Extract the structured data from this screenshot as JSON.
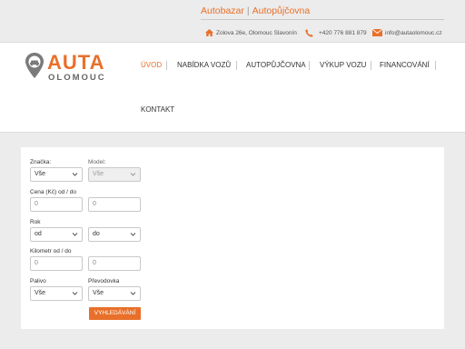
{
  "topbar": {
    "brand_primary": "Autobazar",
    "brand_separator": "|",
    "brand_secondary": "Autopůjčovna",
    "address": "Zolova 26e, Olomouc Slavonín",
    "phone": "+420 776 881 879",
    "email": "info@autaolomouc.cz"
  },
  "logo": {
    "line1": "AUTA",
    "line2": "OLOMOUC"
  },
  "nav": {
    "items": [
      "ÚVOD",
      "NABÍDKA VOZŮ",
      "AUTOPŮJČOVNA",
      "VÝKUP VOZU",
      "FINANCOVÁNÍ",
      "KONTAKT"
    ],
    "active_index": 0
  },
  "search": {
    "brand_label": "Značka:",
    "brand_value": "Vše",
    "model_label": "Model:",
    "model_value": "Vše",
    "price_label": "Cena (Kč) od / do",
    "price_from_placeholder": "0",
    "price_to_placeholder": "0",
    "year_label": "Rok",
    "year_from_value": "od",
    "year_to_value": "do",
    "km_label": "Kilometr od / do",
    "km_from_placeholder": "0",
    "km_to_placeholder": "0",
    "fuel_label": "Palivo",
    "fuel_value": "Vše",
    "gearbox_label": "Převodovka",
    "gearbox_value": "Vše",
    "submit_label": "VYHLEDÁVÁNÍ"
  },
  "colors": {
    "accent": "#e8702a",
    "background": "#ececec",
    "panel": "#ffffff"
  },
  "icons": [
    "home-icon",
    "phone-icon",
    "mail-icon",
    "location-pin-icon",
    "chevron-down-icon"
  ]
}
